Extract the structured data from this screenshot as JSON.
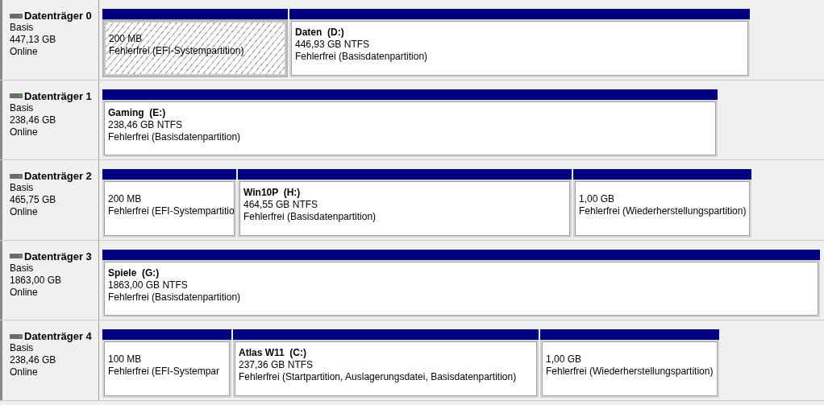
{
  "disks": [
    {
      "name": "Datenträger 0",
      "type": "Basis",
      "size": "447,13 GB",
      "status": "Online",
      "partitions": [
        {
          "size": "200 MB",
          "status": "Fehlerfrei (EFI-Systempartition)",
          "selected": true
        },
        {
          "name": "Daten  (D:)",
          "size": "446,93 GB NTFS",
          "status": "Fehlerfrei (Basisdatenpartition)",
          "selected": false
        }
      ]
    },
    {
      "name": "Datenträger 1",
      "type": "Basis",
      "size": "238,46 GB",
      "status": "Online",
      "partitions": [
        {
          "name": "Gaming  (E:)",
          "size": "238,46 GB NTFS",
          "status": "Fehlerfrei (Basisdatenpartition)",
          "selected": false
        }
      ]
    },
    {
      "name": "Datenträger 2",
      "type": "Basis",
      "size": "465,75 GB",
      "status": "Online",
      "partitions": [
        {
          "size": "200 MB",
          "status": "Fehlerfrei (EFI-Systempartitio",
          "selected": false
        },
        {
          "name": "Win10P  (H:)",
          "size": "464,55 GB NTFS",
          "status": "Fehlerfrei (Basisdatenpartition)",
          "selected": false
        },
        {
          "size": "1,00 GB",
          "status": "Fehlerfrei (Wiederherstellungspartition)",
          "selected": false
        }
      ]
    },
    {
      "name": "Datenträger 3",
      "type": "Basis",
      "size": "1863,00 GB",
      "status": "Online",
      "partitions": [
        {
          "name": "Spiele  (G:)",
          "size": "1863,00 GB NTFS",
          "status": "Fehlerfrei (Basisdatenpartition)",
          "selected": false
        }
      ]
    },
    {
      "name": "Datenträger 4",
      "type": "Basis",
      "size": "238,46 GB",
      "status": "Online",
      "partitions": [
        {
          "size": "100 MB",
          "status": "Fehlerfrei (EFI-Systempar",
          "selected": false
        },
        {
          "name": "Atlas W11  (C:)",
          "size": "237,36 GB NTFS",
          "status": "Fehlerfrei (Startpartition, Auslagerungsdatei, Basisdatenpartition)",
          "selected": false
        },
        {
          "size": "1,00 GB",
          "status": "Fehlerfrei (Wiederherstellungspartition)",
          "selected": false
        }
      ]
    }
  ]
}
